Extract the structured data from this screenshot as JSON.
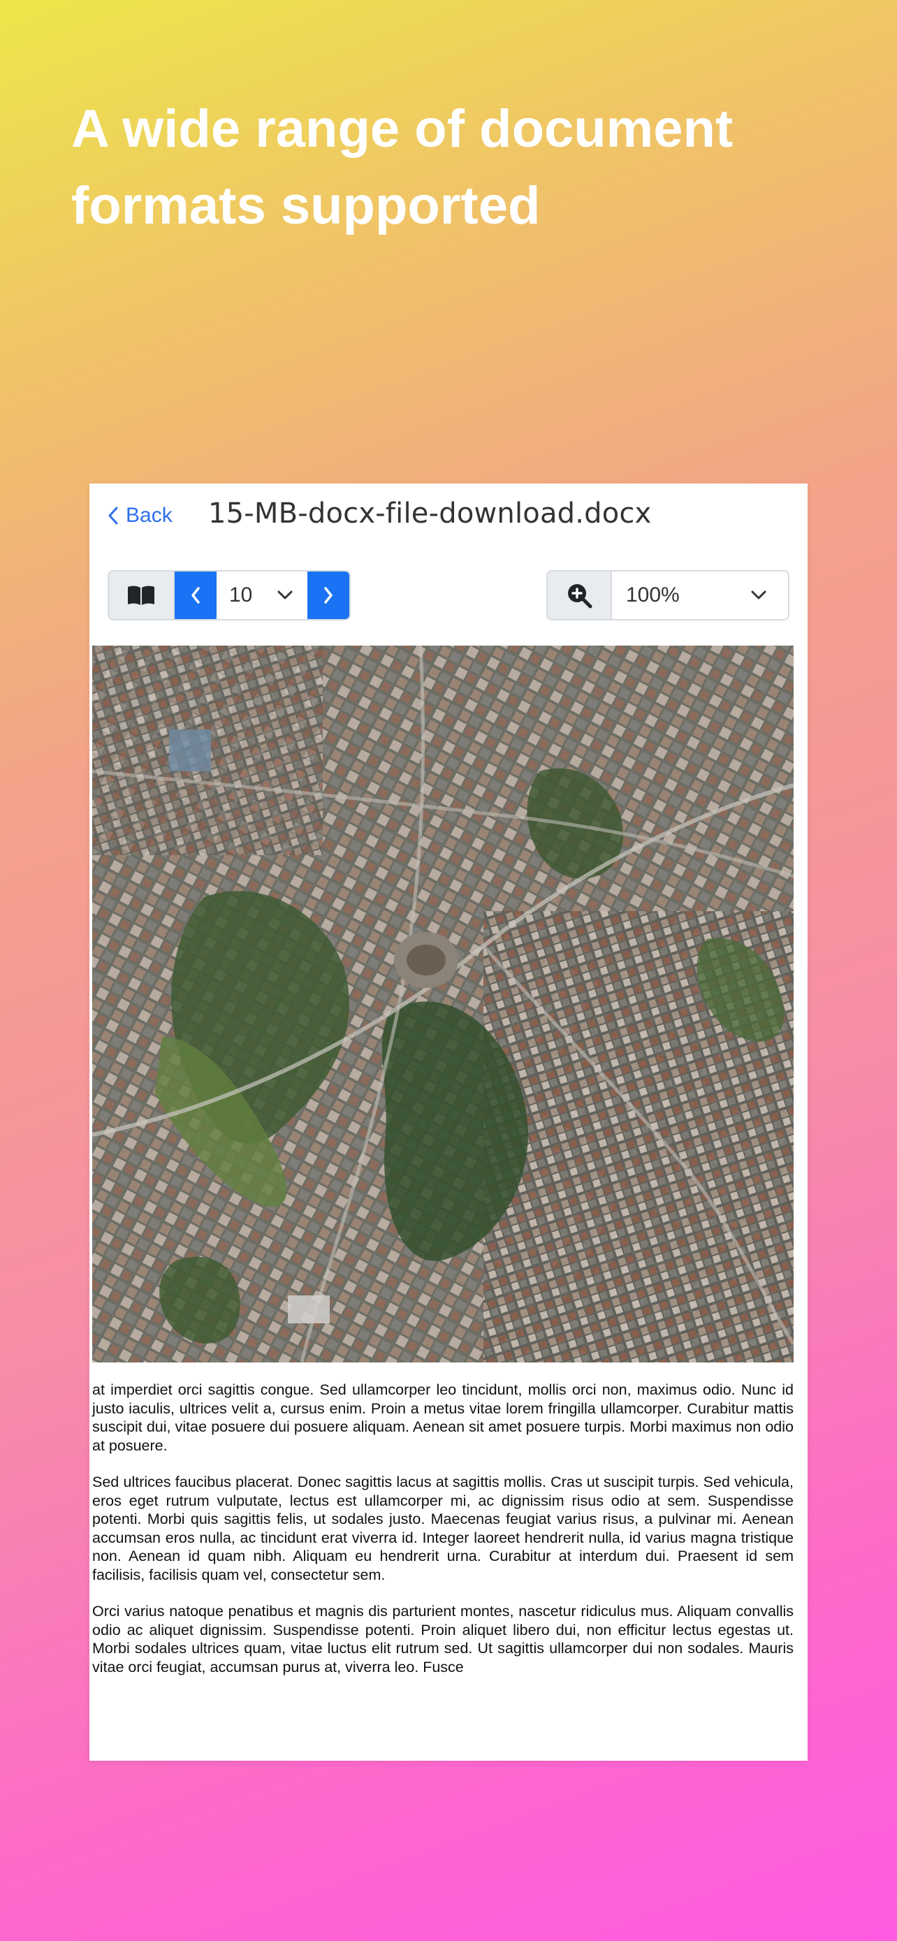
{
  "headline": "A wide range of document formats supported",
  "viewer": {
    "back_label": "Back",
    "file_name": "15-MB-docx-file-download.docx",
    "page_value": "10",
    "zoom_value": "100%"
  },
  "document": {
    "paragraphs": [
      "at imperdiet orci sagittis congue. Sed ullamcorper leo tincidunt, mollis orci non, maximus odio. Nunc id justo iaculis, ultrices velit a, cursus enim. Proin a metus vitae lorem fringilla ullamcorper. Curabitur mattis suscipit dui, vitae posuere dui posuere aliquam. Aenean sit amet posuere turpis. Morbi maximus non odio at posuere.",
      "Sed ultrices faucibus placerat. Donec sagittis lacus at sagittis mollis. Cras ut suscipit turpis. Sed vehicula, eros eget rutrum vulputate, lectus est ullamcorper mi, ac dignissim risus odio at sem. Suspendisse potenti. Morbi quis sagittis felis, ut sodales justo. Maecenas feugiat varius risus, a pulvinar mi. Aenean accumsan eros nulla, ac tincidunt erat viverra id. Integer laoreet hendrerit nulla, id varius magna tristique non. Aenean id quam nibh. Aliquam eu hendrerit urna. Curabitur at interdum dui. Praesent id sem facilisis, facilisis quam vel, consectetur sem.",
      "Orci varius natoque penatibus et magnis dis parturient montes, nascetur ridiculus mus. Aliquam convallis odio ac aliquet dignissim. Suspendisse potenti. Proin aliquet libero dui, non efficitur lectus egestas ut. Morbi sodales ultrices quam, vitae luctus elit rutrum sed. Ut sagittis ullamcorper dui non sodales. Mauris vitae orci feugiat, accumsan purus at, viverra leo. Fusce"
    ]
  },
  "colors": {
    "accent": "#1A73F5",
    "link": "#2F6FEB"
  },
  "icons": [
    "chevron-left-icon",
    "book-icon",
    "chevron-down-icon",
    "chevron-right-icon",
    "zoom-in-icon"
  ]
}
